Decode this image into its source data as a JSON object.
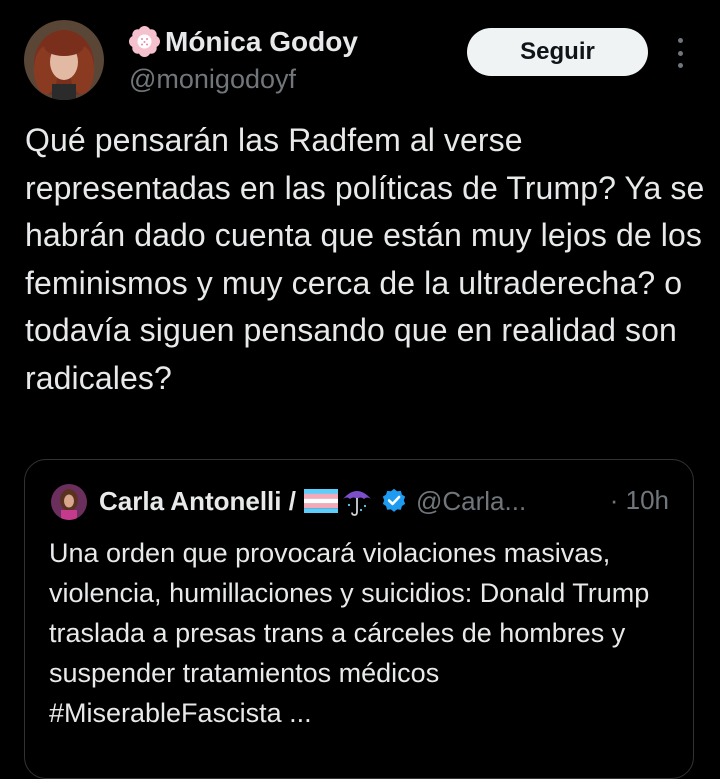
{
  "author": {
    "display_name": "Mónica Godoy",
    "handle": "@monigodoyf",
    "avatar_icon": "avatar-photo",
    "name_icon": "pink-flower-icon"
  },
  "actions": {
    "follow_label": "Seguir",
    "more_icon": "more-vertical-icon"
  },
  "tweet": {
    "text": "Qué pensarán las Radfem al verse representadas en las políticas de Trump? Ya se habrán dado cuenta que están muy lejos de los feminismos y muy cerca de la ultraderecha? o todavía siguen pensando que en realidad son radicales?"
  },
  "quoted_tweet": {
    "display_name": "Carla Antonelli /",
    "name_icons": [
      "transgender-flag-icon",
      "umbrella-icon",
      "verified-badge-icon"
    ],
    "handle": "@Carla...",
    "time": "· 10h",
    "text": "Una orden que provocará violaciones masivas, violencia, humillaciones y suicidios: Donald Trump traslada a presas trans a cárceles de hombres y suspender tratamientos médicos #MiserableFascista ..."
  },
  "colors": {
    "background": "#000000",
    "text": "#e7e9ea",
    "muted": "#71767b",
    "button_bg": "#eff3f4",
    "verified": "#1d9bf0",
    "border": "#2f3336"
  }
}
